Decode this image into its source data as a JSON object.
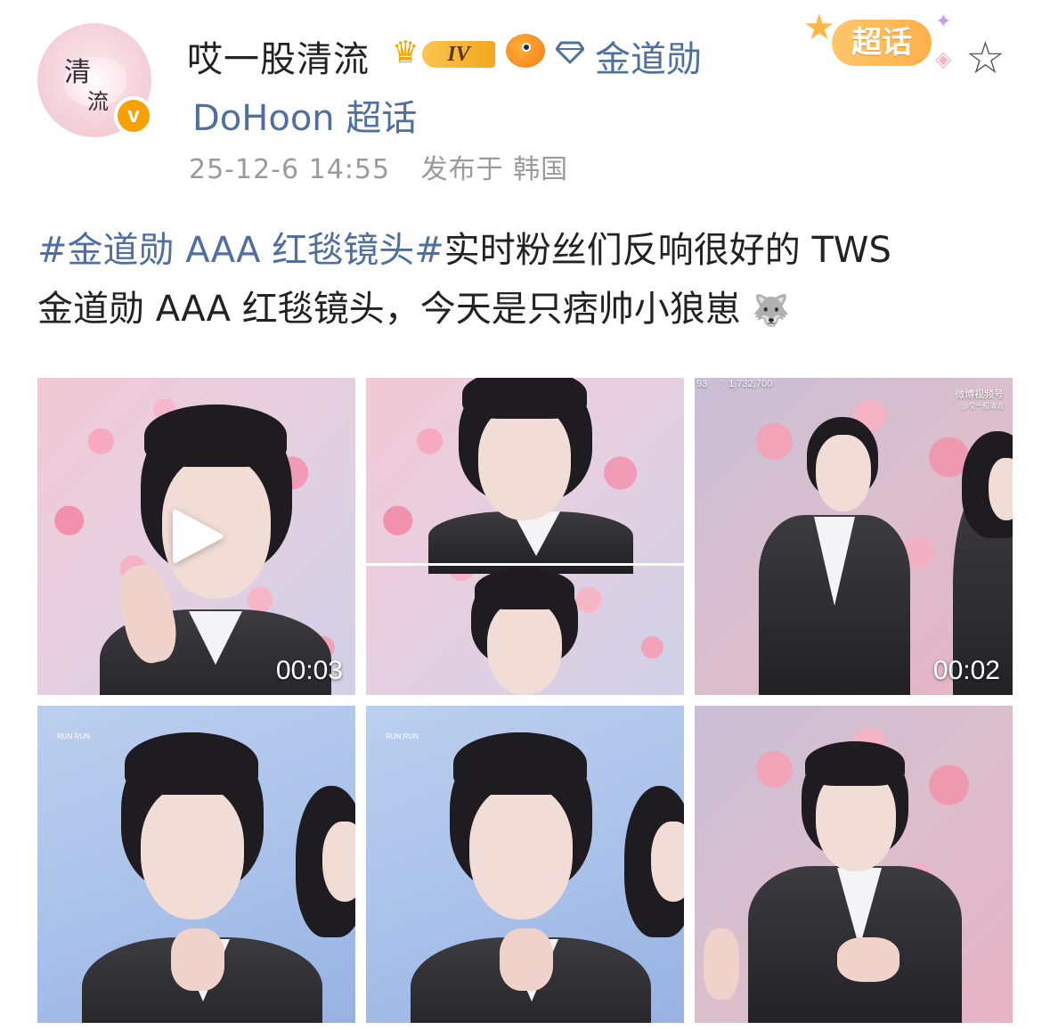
{
  "header": {
    "avatar_text_top": "清",
    "avatar_text_bottom": "流",
    "verified_badge": "v",
    "username": "哎一股清流",
    "level_badge": "IV",
    "topic_link": "金道勋",
    "chaohua_badge": "超话",
    "supertopic": "DoHoon 超话",
    "timestamp": "25-12-6 14:55",
    "location": "发布于 韩国",
    "icons": [
      "crown-icon",
      "fish-icon",
      "diamond-icon",
      "star-icon"
    ]
  },
  "post": {
    "hashtag": "#金道勋 AAA 红毯镜头#",
    "text_line1": "实时粉丝们反响很好的 TWS",
    "text_line2": "金道勋 AAA 红毯镜头，今天是只痞帅小狼崽",
    "emoji": "🐺"
  },
  "media": [
    {
      "type": "video",
      "duration": "00:03"
    },
    {
      "type": "image"
    },
    {
      "type": "video",
      "duration": "00:02",
      "view_count": "93",
      "like_count": "1,732,700",
      "watermark": "微博视频号",
      "watermark_sub": "@哎一股清流"
    },
    {
      "type": "image",
      "watermark": "RUN RUN"
    },
    {
      "type": "image",
      "watermark": "RUN RUN"
    },
    {
      "type": "image"
    }
  ],
  "colors": {
    "link": "#4e6f9f",
    "text": "#222222",
    "meta": "#9a9a9a",
    "badge_orange": "#f7a100"
  }
}
